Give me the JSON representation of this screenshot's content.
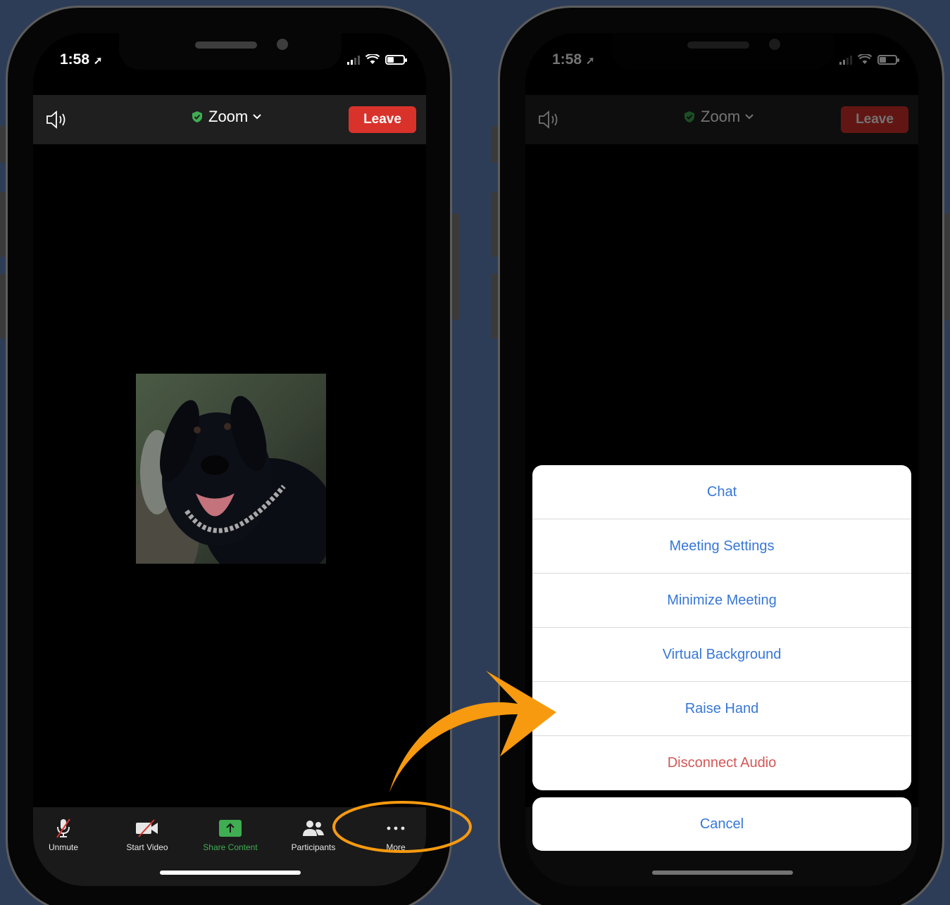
{
  "status_bar": {
    "time": "1:58"
  },
  "meeting": {
    "title": "Zoom",
    "leave_label": "Leave"
  },
  "toolbar": {
    "unmute_label": "Unmute",
    "start_video_label": "Start Video",
    "share_label": "Share Content",
    "participants_label": "Participants",
    "more_label": "More"
  },
  "more_menu": {
    "items": [
      {
        "label": "Chat"
      },
      {
        "label": "Meeting Settings"
      },
      {
        "label": "Minimize Meeting"
      },
      {
        "label": "Virtual Background"
      },
      {
        "label": "Raise Hand"
      },
      {
        "label": "Disconnect Audio"
      }
    ],
    "cancel_label": "Cancel"
  },
  "colors": {
    "background": "#2e3d57",
    "leave_red": "#d9322b",
    "menu_blue": "#3777d6",
    "destructive_red": "#d45656",
    "share_green": "#3fae52",
    "annotation_orange": "#f79a0f"
  }
}
